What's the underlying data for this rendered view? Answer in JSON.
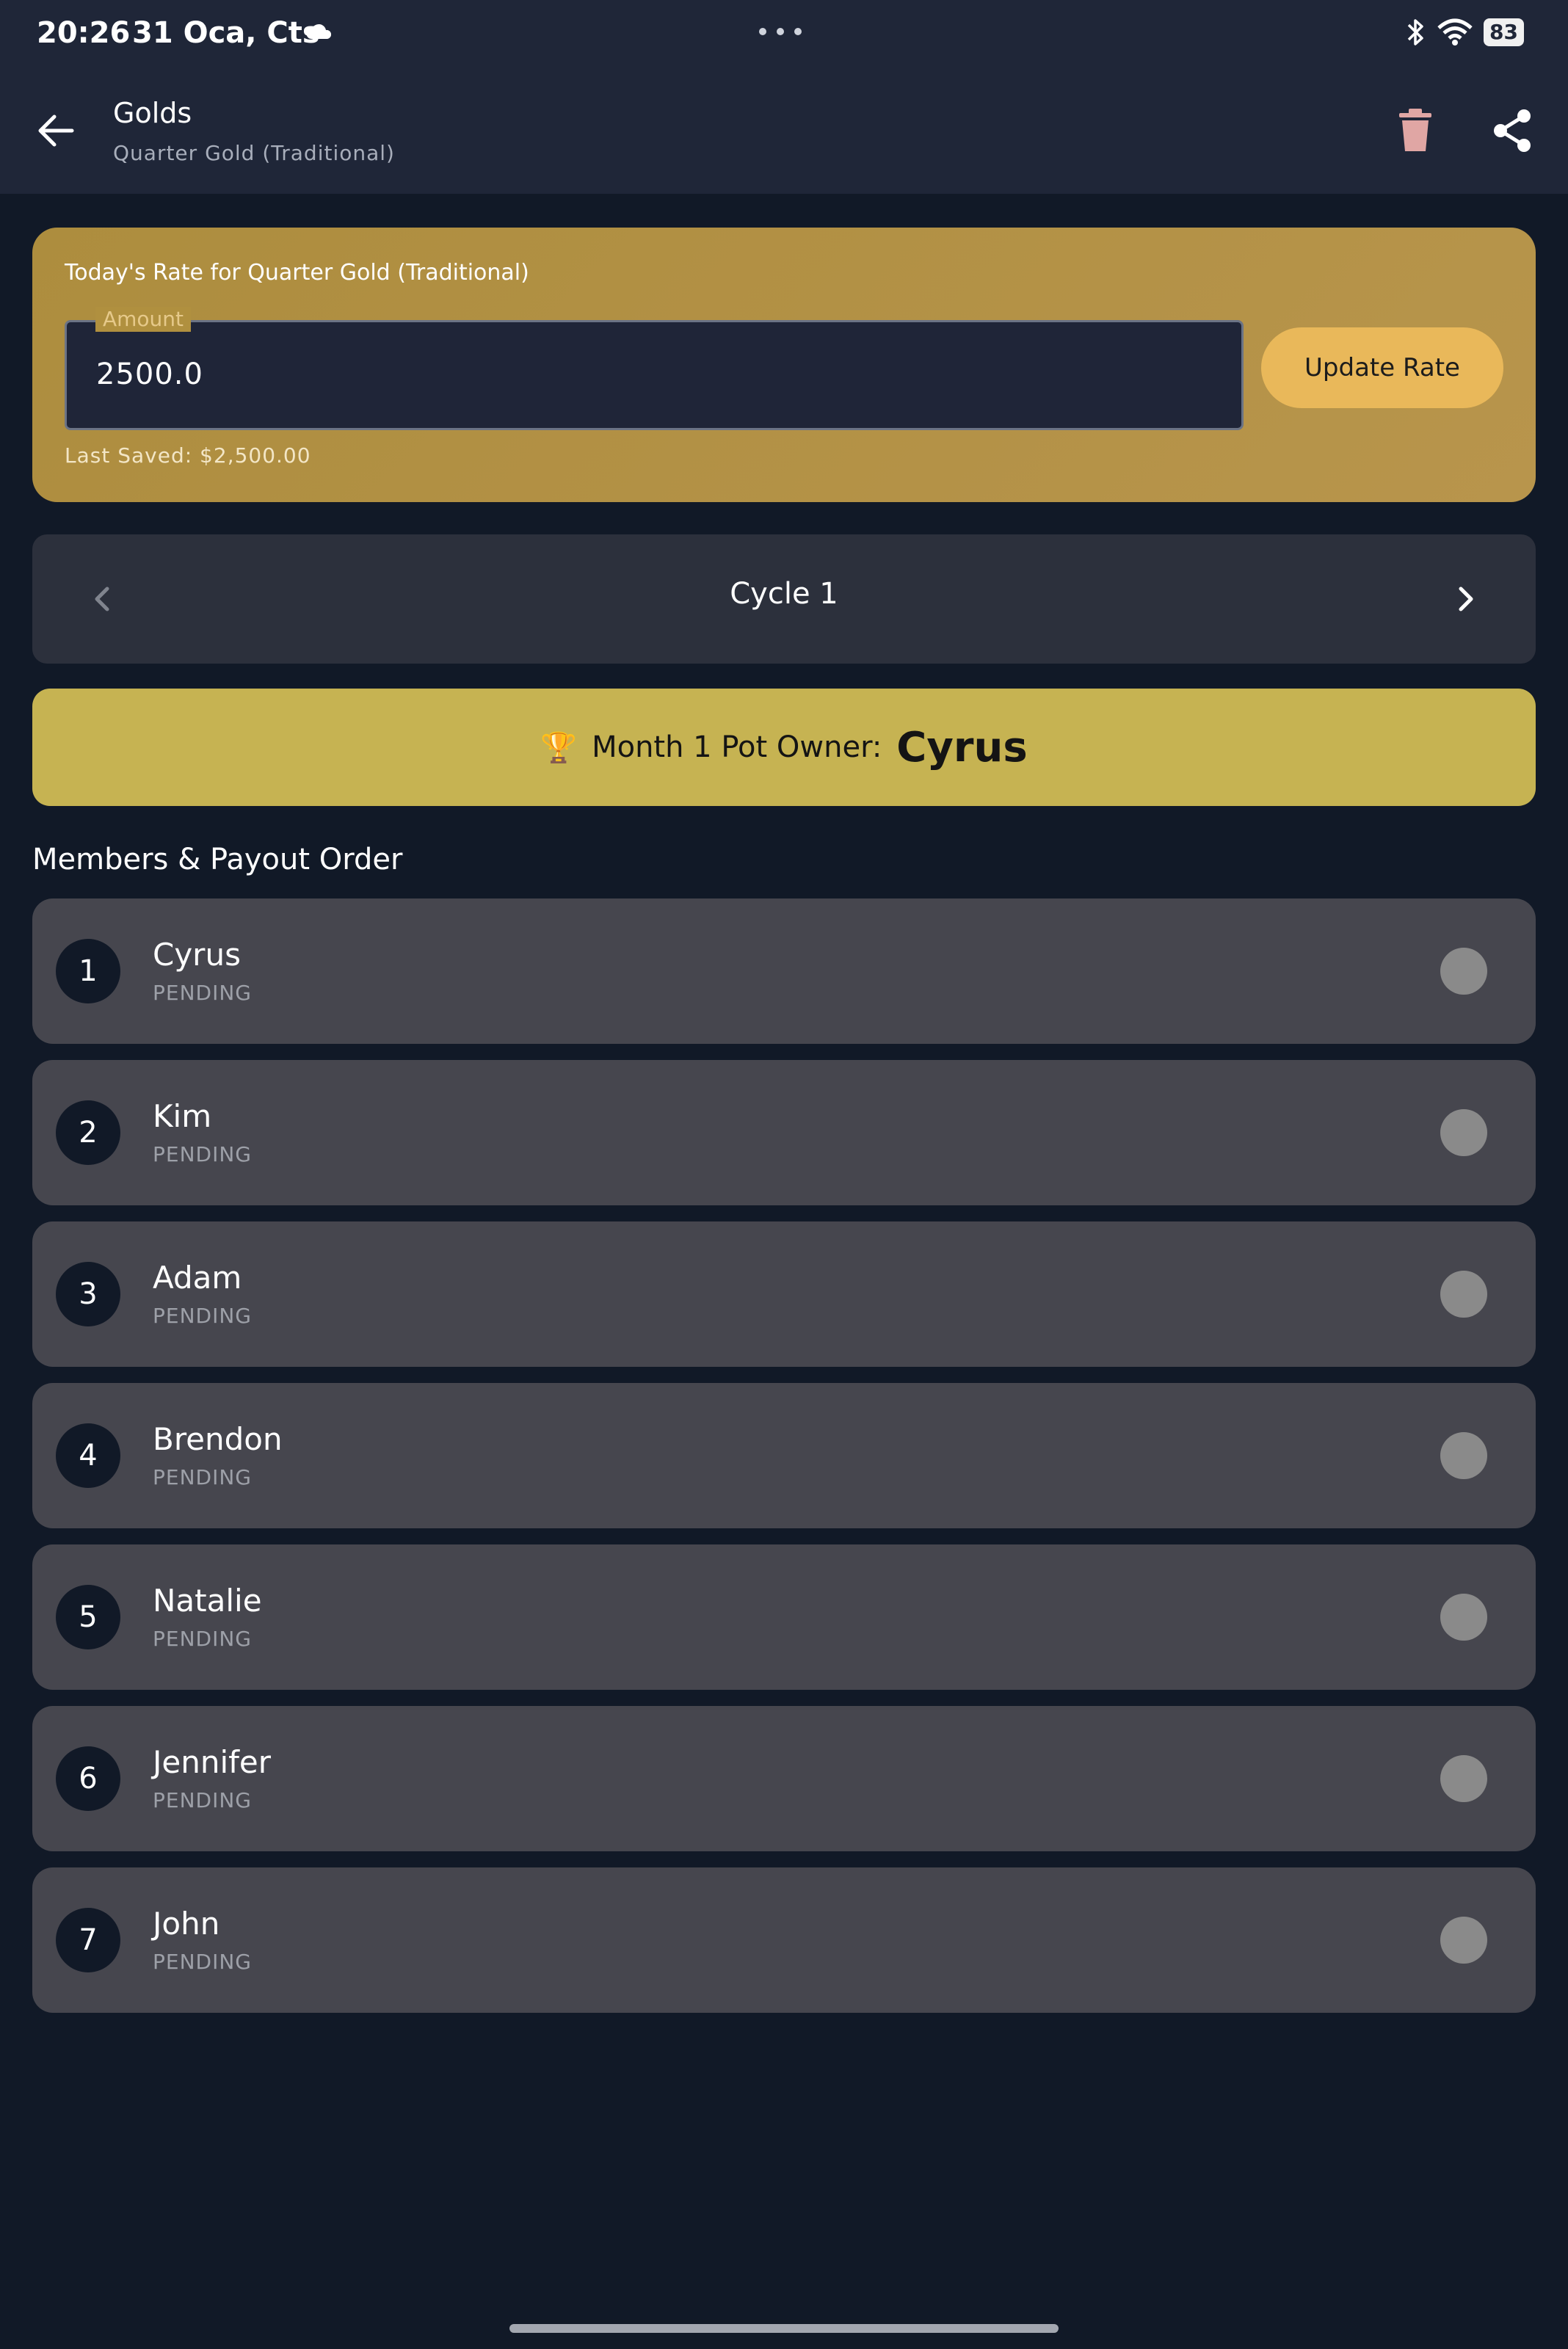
{
  "status_bar": {
    "time": "20:26",
    "date": "31 Oca, Cts",
    "battery": "83"
  },
  "app_bar": {
    "title": "Golds",
    "subtitle": "Quarter Gold (Traditional)",
    "icons": [
      "back-arrow-icon",
      "trash-icon",
      "share-icon"
    ]
  },
  "rate_card": {
    "label": "Today's Rate for Quarter Gold (Traditional)",
    "amount_legend": "Amount",
    "amount_value": "2500.0",
    "update_button": "Update Rate",
    "last_saved": "Last Saved: $2,500.00"
  },
  "cycle": {
    "title": "Cycle 1"
  },
  "pot_owner": {
    "icon": "🏆",
    "label": "Month 1 Pot Owner:",
    "name": "Cyrus"
  },
  "members_section": {
    "title": "Members & Payout Order",
    "members": [
      {
        "number": "1",
        "name": "Cyrus",
        "status": "PENDING"
      },
      {
        "number": "2",
        "name": "Kim",
        "status": "PENDING"
      },
      {
        "number": "3",
        "name": "Adam",
        "status": "PENDING"
      },
      {
        "number": "4",
        "name": "Brendon",
        "status": "PENDING"
      },
      {
        "number": "5",
        "name": "Natalie",
        "status": "PENDING"
      },
      {
        "number": "6",
        "name": "Jennifer",
        "status": "PENDING"
      },
      {
        "number": "7",
        "name": "John",
        "status": "PENDING"
      }
    ]
  },
  "colors": {
    "background": "#111927",
    "app_bar": "#1f2638",
    "rate_card": "#b0903f",
    "update_button": "#e9b85a",
    "pot_owner_banner": "#c6b352",
    "member_row": "#46464e"
  }
}
